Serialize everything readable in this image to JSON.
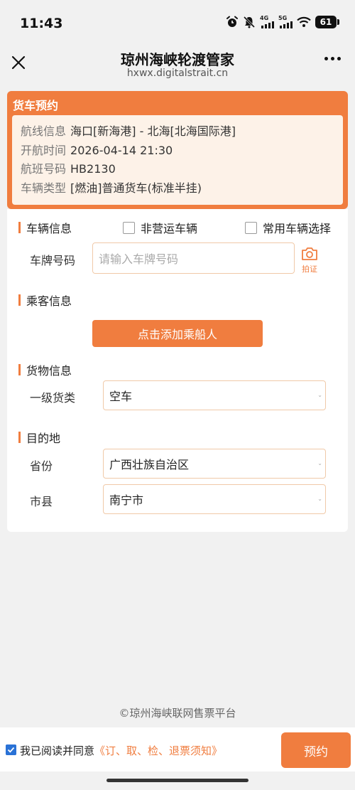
{
  "status_bar": {
    "time": "11:43",
    "net1": "4G",
    "net2": "5G",
    "battery": "61",
    "icons": [
      "alarm-icon",
      "mute-icon",
      "signal-4g-icon",
      "signal-5g-icon",
      "wifi-icon",
      "battery-icon"
    ]
  },
  "navbar": {
    "title": "琼州海峡轮渡管家",
    "url": "hxwx.digitalstrait.cn"
  },
  "booking": {
    "title": "货车预约",
    "rows": [
      {
        "label": "航线信息",
        "value": "海口[新海港] - 北海[北海国际港]"
      },
      {
        "label": "开航时间",
        "value": "2026-04-14 21:30"
      },
      {
        "label": "航班号码",
        "value": "HB2130"
      },
      {
        "label": "车辆类型",
        "value": "[燃油]普通货车(标准半挂)"
      }
    ]
  },
  "vehicle": {
    "title": "车辆信息",
    "non_commercial_label": "非营运车辆",
    "common_vehicle_label": "常用车辆选择",
    "plate_label": "车牌号码",
    "plate_placeholder": "请输入车牌号码",
    "camera_caption": "拍证"
  },
  "passenger": {
    "title": "乘客信息",
    "add_button": "点击添加乘船人"
  },
  "cargo": {
    "title": "货物信息",
    "category_label": "一级货类",
    "category_value": "空车"
  },
  "destination": {
    "title": "目的地",
    "province_label": "省份",
    "province_value": "广西壮族自治区",
    "city_label": "市县",
    "city_value": "南宁市"
  },
  "footer": {
    "copyright": "©琼州海峡联网售票平台"
  },
  "bottom_bar": {
    "agree_text": "我已阅读并同意",
    "agree_link": "《订、取、检、退票须知》",
    "reserve_button": "预约"
  },
  "colors": {
    "accent": "#f07d3f",
    "checkbox_checked": "#2a72d6"
  }
}
